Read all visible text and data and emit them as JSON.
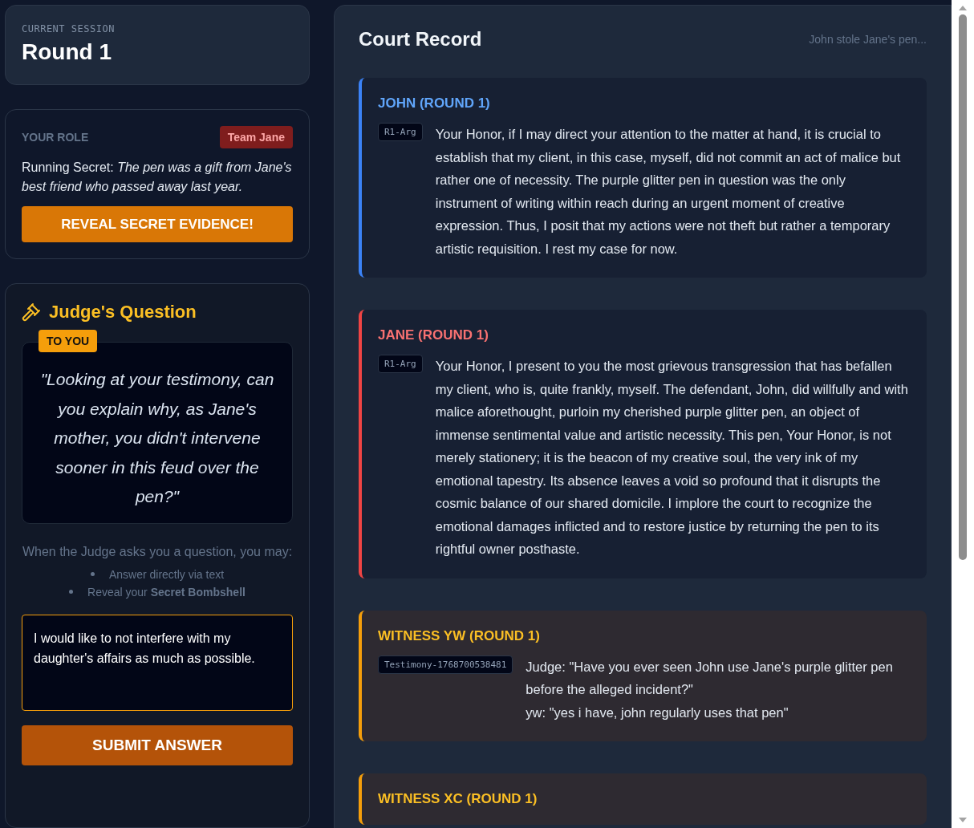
{
  "session": {
    "label": "CURRENT SESSION",
    "title": "Round 1"
  },
  "role": {
    "label": "YOUR ROLE",
    "team": "Team Jane",
    "secret": "Running Secret: *The pen was a gift from Jane's best friend who passed away last year.*",
    "reveal_button": "REVEAL SECRET EVIDENCE!"
  },
  "question": {
    "title": "Judge's Question",
    "badge": "TO YOU",
    "text": "\"Looking at your testimony, can you explain why, as Jane's mother, you didn't intervene sooner in this feud over the pen?\"",
    "hint": "When the Judge asks you a question, you may:",
    "options": [
      "Answer directly via text",
      "Reveal your **Secret Bombshell**"
    ],
    "answer": "I would like to not interfere with my daughter's affairs as much as possible.",
    "submit_button": "SUBMIT ANSWER"
  },
  "record": {
    "title": "Court Record",
    "case": "John stole Jane's pen...",
    "entries": [
      {
        "kind": "argument",
        "color": "#3b82f6",
        "heading": "JOHN (ROUND 1)",
        "tag": "R1-Arg",
        "lines": [
          "Your Honor, if I may direct your attention to the matter at hand, it is crucial to establish that my client, in this case, myself, did not commit an act of malice but rather one of necessity. The purple glitter pen in question was the only instrument of writing within reach during an urgent moment of creative expression. Thus, I posit that my actions were not theft but rather a temporary artistic requisition. I rest my case for now."
        ]
      },
      {
        "kind": "argument",
        "color": "#ef4444",
        "heading": "JANE (ROUND 1)",
        "tag": "R1-Arg",
        "lines": [
          "Your Honor, I present to you the most grievous transgression that has befallen my client, who is, quite frankly, myself. The defendant, John, did willfully and with malice aforethought, purloin my cherished purple glitter pen, an object of immense sentimental value and artistic necessity. This pen, Your Honor, is not merely stationery; it is the beacon of my creative soul, the very ink of my emotional tapestry. Its absence leaves a void so profound that it disrupts the cosmic balance of our shared domicile. I implore the court to recognize the emotional damages inflicted and to restore justice by returning the pen to its rightful owner posthaste."
        ]
      },
      {
        "kind": "testimony",
        "color": "#f59e0b",
        "heading": "WITNESS YW (ROUND 1)",
        "tag": "Testimony-1768700538481",
        "lines": [
          "Judge: \"Have you ever seen John use Jane's purple glitter pen before the alleged incident?\"",
          "yw: \"yes i have, john regularly uses that pen\""
        ]
      },
      {
        "kind": "testimony",
        "color": "#f59e0b",
        "heading": "WITNESS XC (ROUND 1)"
      }
    ]
  }
}
